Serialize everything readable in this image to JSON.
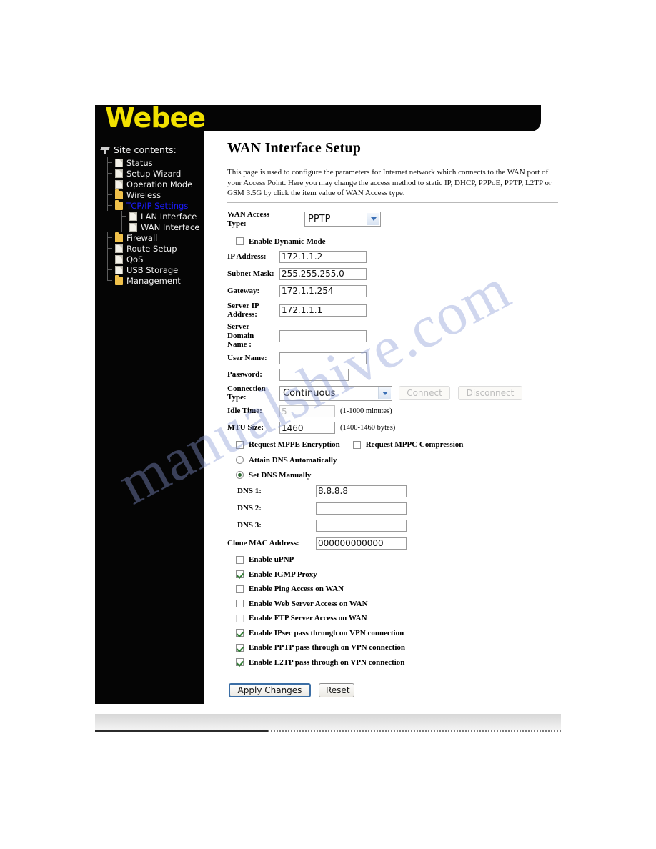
{
  "brand": {
    "logo_text": "Webee"
  },
  "sidebar": {
    "heading": "Site contents:",
    "items": [
      {
        "label": "Status",
        "icon": "document-icon",
        "type": "doc",
        "level": 0,
        "selected": false
      },
      {
        "label": "Setup Wizard",
        "icon": "document-icon",
        "type": "doc",
        "level": 0,
        "selected": false
      },
      {
        "label": "Operation Mode",
        "icon": "document-icon",
        "type": "doc",
        "level": 0,
        "selected": false
      },
      {
        "label": "Wireless",
        "icon": "folder-icon",
        "type": "folder",
        "level": 0,
        "selected": false
      },
      {
        "label": "TCP/IP Settings",
        "icon": "folder-open-icon",
        "type": "folder",
        "level": 0,
        "selected": true
      },
      {
        "label": "LAN Interface",
        "icon": "document-icon",
        "type": "doc",
        "level": 1,
        "selected": false
      },
      {
        "label": "WAN Interface",
        "icon": "document-icon",
        "type": "doc",
        "level": 1,
        "selected": false
      },
      {
        "label": "Firewall",
        "icon": "folder-icon",
        "type": "folder",
        "level": 0,
        "selected": false
      },
      {
        "label": "Route Setup",
        "icon": "document-icon",
        "type": "doc",
        "level": 0,
        "selected": false
      },
      {
        "label": "QoS",
        "icon": "document-icon",
        "type": "doc",
        "level": 0,
        "selected": false
      },
      {
        "label": "USB Storage",
        "icon": "document-icon",
        "type": "doc",
        "level": 0,
        "selected": false
      },
      {
        "label": "Management",
        "icon": "folder-icon",
        "type": "folder",
        "level": 0,
        "selected": false
      }
    ]
  },
  "main": {
    "title": "WAN Interface Setup",
    "description": "This page is used to configure the parameters for Internet network which connects to the WAN port of your Access Point. Here you may change the access method to static IP, DHCP, PPPoE, PPTP, L2TP or GSM 3.5G by click the item value of WAN Access type.",
    "wan_access_type": {
      "label": "WAN Access Type:",
      "value": "PPTP"
    },
    "enable_dynamic_mode": {
      "label": "Enable Dynamic Mode",
      "checked": false
    },
    "fields": [
      {
        "label": "IP Address:",
        "value": "172.1.1.2",
        "disabled": false
      },
      {
        "label": "Subnet Mask:",
        "value": "255.255.255.0",
        "disabled": false
      },
      {
        "label": "Gateway:",
        "value": "172.1.1.254",
        "disabled": false
      }
    ],
    "server_ip": {
      "label_line1": "Server IP",
      "label_line2": "Address:",
      "value": "172.1.1.1"
    },
    "server_domain": {
      "label_line1": "Server",
      "label_line2": "Domain",
      "label_line3": "Name :",
      "value": ""
    },
    "user_name": {
      "label": "User Name:",
      "value": ""
    },
    "password": {
      "label": "Password:",
      "value": ""
    },
    "connection_type": {
      "label_line1": "Connection",
      "label_line2": "Type:",
      "value": "Continuous",
      "connect_label": "Connect",
      "disconnect_label": "Disconnect"
    },
    "idle_time": {
      "label": "Idle Time:",
      "value": "5",
      "hint": "(1-1000 minutes)",
      "disabled": true
    },
    "mtu_size": {
      "label": "MTU Size:",
      "value": "1460",
      "hint": "(1400-1460 bytes)",
      "disabled": false
    },
    "mppe": {
      "label": "Request MPPE Encryption",
      "checked": false
    },
    "mppc": {
      "label": "Request MPPC Compression",
      "checked": false
    },
    "dns_mode": {
      "auto": {
        "label": "Attain DNS Automatically",
        "selected": false
      },
      "manual": {
        "label": "Set DNS Manually",
        "selected": true
      }
    },
    "dns_fields": [
      {
        "label": "DNS 1:",
        "value": "8.8.8.8"
      },
      {
        "label": "DNS 2:",
        "value": ""
      },
      {
        "label": "DNS 3:",
        "value": ""
      }
    ],
    "clone_mac": {
      "label": "Clone MAC Address:",
      "value": "000000000000"
    },
    "options": [
      {
        "label": "Enable uPNP",
        "checked": false,
        "faint": false
      },
      {
        "label": "Enable IGMP Proxy",
        "checked": true,
        "faint": false
      },
      {
        "label": "Enable Ping Access on WAN",
        "checked": false,
        "faint": false
      },
      {
        "label": "Enable Web Server Access on WAN",
        "checked": false,
        "faint": false
      },
      {
        "label": "Enable FTP Server Access on WAN",
        "checked": false,
        "faint": true
      },
      {
        "label": "Enable IPsec pass through on VPN connection",
        "checked": true,
        "faint": false
      },
      {
        "label": "Enable PPTP pass through on VPN connection",
        "checked": true,
        "faint": false
      },
      {
        "label": "Enable L2TP pass through on VPN connection",
        "checked": true,
        "faint": false
      }
    ],
    "actions": {
      "apply_label": "Apply Changes",
      "reset_label": "Reset"
    }
  },
  "watermark": {
    "text": "manualshive.com"
  },
  "colors": {
    "logo_yellow": "#f2e100",
    "banner_black": "#050505",
    "selected_blue": "#1b1bff",
    "folder_yellow": "#f0c14b",
    "check_green": "#2f7d32",
    "focus_blue": "#3b6ea5"
  }
}
